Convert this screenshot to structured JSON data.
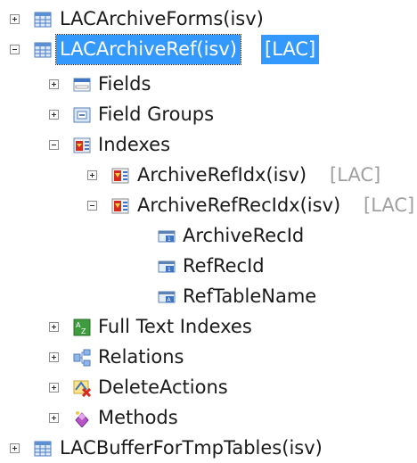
{
  "tree": {
    "root1": {
      "label": "LACArchiveForms(isv)"
    },
    "root2": {
      "label": "LACArchiveRef(isv)",
      "tag": "[LAC]"
    },
    "children": {
      "fields": "Fields",
      "field_groups": "Field Groups",
      "indexes": "Indexes",
      "idx1": {
        "label": "ArchiveRefIdx(isv)",
        "tag": "[LAC]"
      },
      "idx2": {
        "label": "ArchiveRefRecIdx(isv)",
        "tag": "[LAC]"
      },
      "idx2_fields": [
        "ArchiveRecId",
        "RefRecId",
        "RefTableName"
      ],
      "full_text": "Full Text Indexes",
      "relations": "Relations",
      "delete_actions": "DeleteActions",
      "methods": "Methods"
    },
    "root3": {
      "label": "LACBufferForTmpTables(isv)"
    }
  },
  "colors": {
    "selection": "#3399ff",
    "tag": "#a0a0a0"
  }
}
